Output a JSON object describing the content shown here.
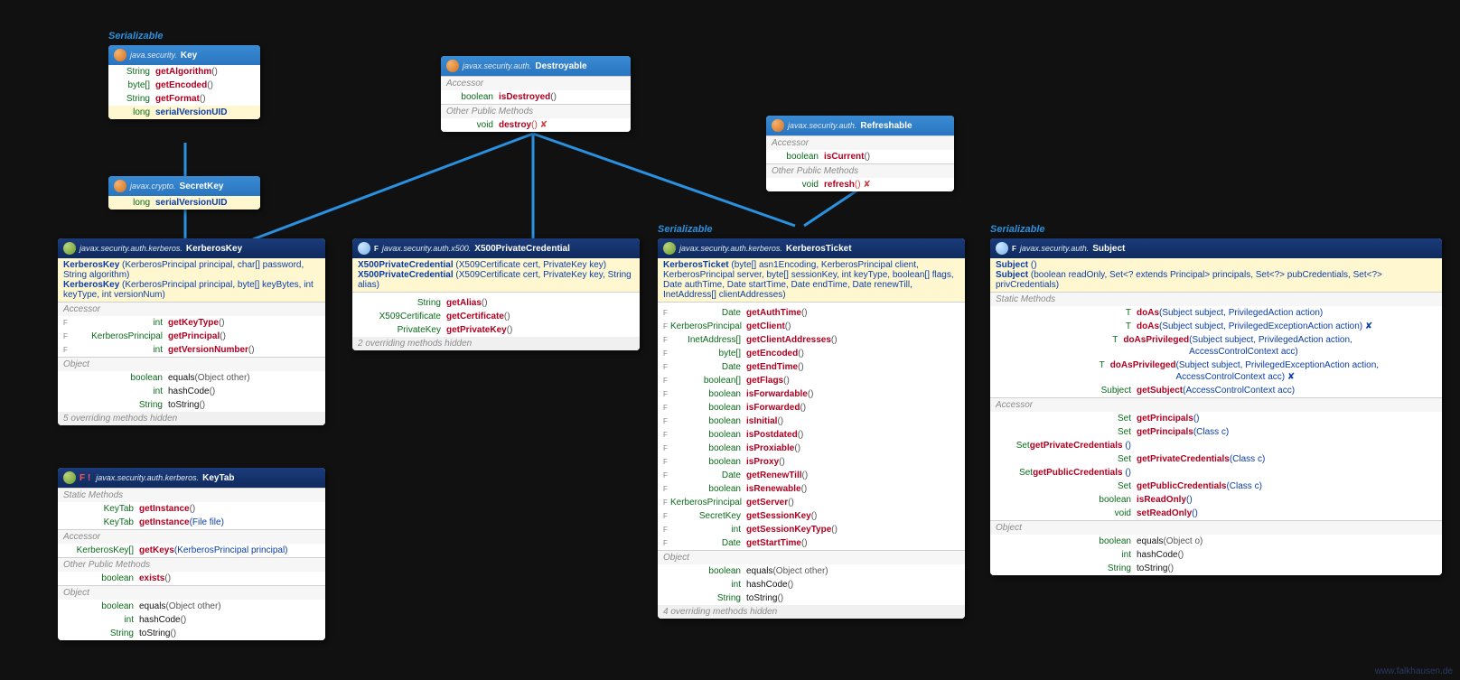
{
  "credit": "www.falkhausen.de",
  "labels": {
    "serial": "Serializable",
    "acc": "Accessor",
    "obj": "Object",
    "opm": "Other Public Methods",
    "sm": "Static Methods"
  },
  "key": {
    "pkg": "java.security.",
    "name": "Key",
    "m": [
      [
        "String",
        "getAlgorithm",
        "()"
      ],
      [
        "byte[]",
        "getEncoded",
        "()"
      ],
      [
        "String",
        "getFormat",
        "()"
      ]
    ],
    "f": [
      [
        "long",
        "serialVersionUID"
      ]
    ]
  },
  "secretkey": {
    "pkg": "javax.crypto.",
    "name": "SecretKey",
    "f": [
      [
        "long",
        "serialVersionUID"
      ]
    ]
  },
  "destroyable": {
    "pkg": "javax.security.auth.",
    "name": "Destroyable",
    "acc": [
      [
        "boolean",
        "isDestroyed",
        "()"
      ]
    ],
    "opm": [
      [
        "void",
        "destroy",
        "() ✘"
      ]
    ]
  },
  "refreshable": {
    "pkg": "javax.security.auth.",
    "name": "Refreshable",
    "acc": [
      [
        "boolean",
        "isCurrent",
        "()"
      ]
    ],
    "opm": [
      [
        "void",
        "refresh",
        "() ✘"
      ]
    ]
  },
  "kerberoskey": {
    "pkg": "javax.security.auth.kerberos.",
    "name": "KerberosKey",
    "cons": [
      [
        "KerberosKey",
        "(KerberosPrincipal principal, char[] password, String algorithm)"
      ],
      [
        "KerberosKey",
        "(KerberosPrincipal principal, byte[] keyBytes, int keyType, int versionNum)"
      ]
    ],
    "acc": [
      [
        "int",
        "getKeyType",
        "()"
      ],
      [
        "KerberosPrincipal",
        "getPrincipal",
        "()"
      ],
      [
        "int",
        "getVersionNumber",
        "()"
      ]
    ],
    "obj": [
      [
        "boolean",
        "equals",
        "(Object other)"
      ],
      [
        "int",
        "hashCode",
        "()"
      ],
      [
        "String",
        "toString",
        "()"
      ]
    ],
    "note": "5 overriding methods hidden"
  },
  "keytab": {
    "pkg": "javax.security.auth.kerberos.",
    "name": "KeyTab",
    "sm": [
      [
        "KeyTab",
        "getInstance",
        "()"
      ],
      [
        "KeyTab",
        "getInstance",
        "(File file)"
      ]
    ],
    "acc": [
      [
        "KerberosKey[]",
        "getKeys",
        "(KerberosPrincipal principal)"
      ]
    ],
    "opm": [
      [
        "boolean",
        "exists",
        "()"
      ]
    ],
    "obj": [
      [
        "boolean",
        "equals",
        "(Object other)"
      ],
      [
        "int",
        "hashCode",
        "()"
      ],
      [
        "String",
        "toString",
        "()"
      ]
    ]
  },
  "x500": {
    "pkg": "javax.security.auth.x500.",
    "name": "X500PrivateCredential",
    "cons": [
      [
        "X500PrivateCredential",
        "(X509Certificate cert, PrivateKey key)"
      ],
      [
        "X500PrivateCredential",
        "(X509Certificate cert, PrivateKey key, String alias)"
      ]
    ],
    "m": [
      [
        "String",
        "getAlias",
        "()"
      ],
      [
        "X509Certificate",
        "getCertificate",
        "()"
      ],
      [
        "PrivateKey",
        "getPrivateKey",
        "()"
      ]
    ],
    "note": "2 overriding methods hidden"
  },
  "ticket": {
    "pkg": "javax.security.auth.kerberos.",
    "name": "KerberosTicket",
    "cons": [
      [
        "KerberosTicket",
        "(byte[] asn1Encoding, KerberosPrincipal client, KerberosPrincipal server, byte[] sessionKey, int keyType, boolean[] flags, Date authTime, Date startTime, Date endTime, Date renewTill, InetAddress[] clientAddresses)"
      ]
    ],
    "acc": [
      [
        "Date",
        "getAuthTime",
        "()"
      ],
      [
        "KerberosPrincipal",
        "getClient",
        "()"
      ],
      [
        "InetAddress[]",
        "getClientAddresses",
        "()"
      ],
      [
        "byte[]",
        "getEncoded",
        "()"
      ],
      [
        "Date",
        "getEndTime",
        "()"
      ],
      [
        "boolean[]",
        "getFlags",
        "()"
      ],
      [
        "boolean",
        "isForwardable",
        "()"
      ],
      [
        "boolean",
        "isForwarded",
        "()"
      ],
      [
        "boolean",
        "isInitial",
        "()"
      ],
      [
        "boolean",
        "isPostdated",
        "()"
      ],
      [
        "boolean",
        "isProxiable",
        "()"
      ],
      [
        "boolean",
        "isProxy",
        "()"
      ],
      [
        "Date",
        "getRenewTill",
        "()"
      ],
      [
        "boolean",
        "isRenewable",
        "()"
      ],
      [
        "KerberosPrincipal",
        "getServer",
        "()"
      ],
      [
        "SecretKey",
        "getSessionKey",
        "()"
      ],
      [
        "int",
        "getSessionKeyType",
        "()"
      ],
      [
        "Date",
        "getStartTime",
        "()"
      ]
    ],
    "obj": [
      [
        "boolean",
        "equals",
        "(Object other)"
      ],
      [
        "int",
        "hashCode",
        "()"
      ],
      [
        "String",
        "toString",
        "()"
      ]
    ],
    "note": "4 overriding methods hidden"
  },
  "subject": {
    "pkg": "javax.security.auth.",
    "name": "Subject",
    "cons": [
      [
        "Subject",
        "()"
      ],
      [
        "Subject",
        "(boolean readOnly, Set<? extends Principal> principals, Set<?> pubCredentials, Set<?> privCredentials)"
      ]
    ],
    "sm": [
      [
        "<T> T",
        "doAs",
        "(Subject subject, PrivilegedAction<T> action)"
      ],
      [
        "<T> T",
        "doAs",
        "(Subject subject, PrivilegedExceptionAction<T> action) ✘"
      ],
      [
        "<T> T",
        "doAsPrivileged",
        "(Subject subject, PrivilegedAction<T> action, AccessControlContext acc)"
      ],
      [
        "<T> T",
        "doAsPrivileged",
        "(Subject subject, PrivilegedExceptionAction<T> action, AccessControlContext acc) ✘"
      ],
      [
        "Subject",
        "getSubject",
        "(AccessControlContext acc)"
      ]
    ],
    "acc": [
      [
        "Set<Principal>",
        "getPrincipals",
        "()"
      ],
      [
        "<T extends Principal> Set<T>",
        "getPrincipals",
        "(Class<T> c)"
      ],
      [
        "Set<Object>",
        "getPrivateCredentials",
        "()"
      ],
      [
        "<T> Set<T>",
        "getPrivateCredentials",
        "(Class<T> c)"
      ],
      [
        "Set<Object>",
        "getPublicCredentials",
        "()"
      ],
      [
        "<T> Set<T>",
        "getPublicCredentials",
        "(Class<T> c)"
      ],
      [
        "boolean",
        "isReadOnly",
        "()"
      ],
      [
        "void",
        "setReadOnly",
        "()"
      ]
    ],
    "obj": [
      [
        "boolean",
        "equals",
        "(Object o)"
      ],
      [
        "int",
        "hashCode",
        "()"
      ],
      [
        "String",
        "toString",
        "()"
      ]
    ]
  },
  "chart_data": {
    "type": "diagram",
    "description": "UML-style class/interface diagram for javax.security.auth credentials",
    "nodes": [
      {
        "id": "Key",
        "kind": "interface",
        "pkg": "java.security"
      },
      {
        "id": "SecretKey",
        "kind": "interface",
        "pkg": "javax.crypto",
        "extends": [
          "Key"
        ]
      },
      {
        "id": "Destroyable",
        "kind": "interface",
        "pkg": "javax.security.auth"
      },
      {
        "id": "Refreshable",
        "kind": "interface",
        "pkg": "javax.security.auth"
      },
      {
        "id": "KerberosKey",
        "kind": "class",
        "pkg": "javax.security.auth.kerberos",
        "implements": [
          "SecretKey",
          "Destroyable",
          "Serializable"
        ]
      },
      {
        "id": "KeyTab",
        "kind": "class",
        "pkg": "javax.security.auth.kerberos"
      },
      {
        "id": "X500PrivateCredential",
        "kind": "class",
        "pkg": "javax.security.auth.x500",
        "implements": [
          "Destroyable"
        ]
      },
      {
        "id": "KerberosTicket",
        "kind": "class",
        "pkg": "javax.security.auth.kerberos",
        "implements": [
          "Destroyable",
          "Refreshable",
          "Serializable"
        ]
      },
      {
        "id": "Subject",
        "kind": "class",
        "pkg": "javax.security.auth",
        "implements": [
          "Serializable"
        ]
      }
    ],
    "edges": [
      [
        "SecretKey",
        "Key"
      ],
      [
        "KerberosKey",
        "SecretKey"
      ],
      [
        "KerberosKey",
        "Destroyable"
      ],
      [
        "X500PrivateCredential",
        "Destroyable"
      ],
      [
        "KerberosTicket",
        "Destroyable"
      ],
      [
        "KerberosTicket",
        "Refreshable"
      ]
    ]
  }
}
